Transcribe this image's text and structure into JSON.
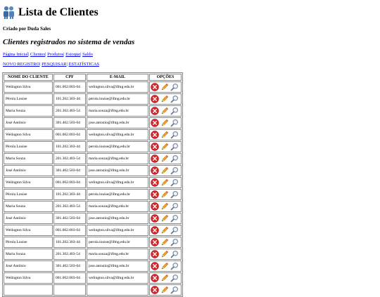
{
  "header": {
    "title": "Lista de Clientes",
    "author": "Criado por Duda Sales",
    "subtitle": "Clientes registrados no sistema de vendas"
  },
  "nav": {
    "pagina_inicial": "Página Inicial",
    "clientes": "Clientes",
    "produtos": "Produtos",
    "estoque": "Estoque",
    "saldo": "Saldo",
    "separator": "|"
  },
  "actions": {
    "novo_registro": "NOVO REGISTRO",
    "pesquisar": "PESQUISAR",
    "estatisticas": "ESTATÍSTICAS"
  },
  "table": {
    "headers": [
      "NOME DO CLIENTE",
      "CPF",
      "E-MAIL",
      "OPÇÕES"
    ],
    "rows": [
      {
        "nome": "Welington Silva",
        "cpf": "001.002.003-04",
        "email": "welington.silva@ifmg.edu.br"
      },
      {
        "nome": "Pérola Louise",
        "cpf": "101.202.303-44",
        "email": "perola.louise@ifmg.edu.br"
      },
      {
        "nome": "Maria Souza",
        "cpf": "201.302.403-54",
        "email": "maria.souza@ifmg.edu.br"
      },
      {
        "nome": "José Antônio",
        "cpf": "301.402.503-04",
        "email": "jose.antonio@ifmg.edu.br"
      },
      {
        "nome": "Welington Silva",
        "cpf": "001.002.003-04",
        "email": "welington.silva@ifmg.edu.br"
      },
      {
        "nome": "Pérola Louise",
        "cpf": "101.202.303-44",
        "email": "perola.louise@ifmg.edu.br"
      },
      {
        "nome": "Maria Souza",
        "cpf": "201.302.403-54",
        "email": "maria.souza@ifmg.edu.br"
      },
      {
        "nome": "José Antônio",
        "cpf": "301.402.503-04",
        "email": "jose.antonio@ifmg.edu.br"
      },
      {
        "nome": "Welington Silva",
        "cpf": "001.002.003-04",
        "email": "welington.silva@ifmg.edu.br"
      },
      {
        "nome": "Pérola Louise",
        "cpf": "101.202.303-44",
        "email": "perola.louise@ifmg.edu.br"
      },
      {
        "nome": "Maria Souza",
        "cpf": "201.302.403-54",
        "email": "maria.souza@ifmg.edu.br"
      },
      {
        "nome": "José Antônio",
        "cpf": "301.402.503-04",
        "email": "jose.antonio@ifmg.edu.br"
      },
      {
        "nome": "Welington Silva",
        "cpf": "001.002.003-04",
        "email": "welington.silva@ifmg.edu.br"
      },
      {
        "nome": "Pérola Louise",
        "cpf": "101.202.303-44",
        "email": "perola.louise@ifmg.edu.br"
      },
      {
        "nome": "Maria Souza",
        "cpf": "201.302.403-54",
        "email": "maria.souza@ifmg.edu.br"
      },
      {
        "nome": "José Antônio",
        "cpf": "301.402.503-04",
        "email": "jose.antonio@ifmg.edu.br"
      },
      {
        "nome": "Welington Silva",
        "cpf": "001.002.003-04",
        "email": "welington.silva@ifmg.edu.br"
      },
      {
        "nome": "",
        "cpf": "",
        "email": ""
      }
    ],
    "row_icons": [
      "delete-icon",
      "edit-pencil-icon",
      "view-magnifier-icon"
    ]
  },
  "icons": {
    "title_icon": "users-icon"
  },
  "colors": {
    "link": "#0000ee",
    "delete_red": "#d9262b",
    "pencil_orange": "#f0a020",
    "border": "#888888"
  }
}
